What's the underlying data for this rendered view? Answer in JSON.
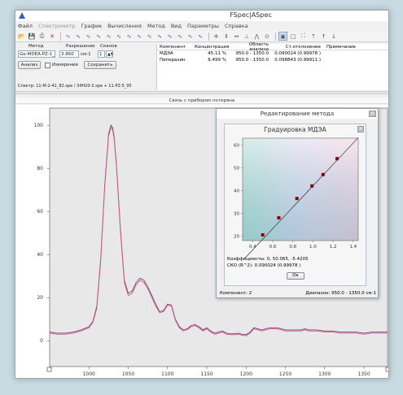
{
  "app": {
    "title": "FSpec|ASpec",
    "menu": [
      {
        "label": "Файл",
        "disabled": false
      },
      {
        "label": "Спектрометр",
        "disabled": true
      },
      {
        "label": "График",
        "disabled": false
      },
      {
        "label": "Вычисления",
        "disabled": false
      },
      {
        "label": "Метод",
        "disabled": false
      },
      {
        "label": "Вид",
        "disabled": false
      },
      {
        "label": "Параметры",
        "disabled": false
      },
      {
        "label": "Справка",
        "disabled": false
      }
    ],
    "toolbar_icons": [
      "open-icon",
      "save-icon",
      "print-icon",
      "delete-icon",
      "spectrum-tool-1-icon",
      "spectrum-tool-2-icon",
      "spectrum-tool-3-icon",
      "spectrum-tool-4-icon",
      "spectrum-tool-5-icon",
      "spectrum-tool-6-icon",
      "spectrum-tool-7-icon",
      "spectrum-tool-8-icon",
      "spectrum-tool-9-icon",
      "spectrum-tool-10-icon",
      "spectrum-tool-11-icon",
      "spectrum-tool-12-icon",
      "spectrum-tool-13-icon",
      "spectrum-tool-14-icon",
      "cursor-cross-icon",
      "vertical-line-icon",
      "horizontal-arrows-icon",
      "baseline-icon",
      "peak-icon",
      "zoom-reset-icon",
      "monitor-icon",
      "square-icon",
      "fit-icon",
      "up-arrow-1-icon",
      "up-arrow-2-icon",
      "down-arrow-icon"
    ]
  },
  "controls": {
    "method_label": "Метод",
    "method_value": "Ge-MDEA-PZ-1_0",
    "resolution_label": "Разрешение",
    "resolution_value": "3.860",
    "resolution_unit": "см-1",
    "scans_label": "Сканов",
    "scans_value": "1",
    "analyze_button": "Анализ",
    "measurement_label": "Измерение",
    "save_button": "Сохранить",
    "spectrum_line": "Спектр: 11-M-2-41_82.spe / 34H20-3.spe + 11-PZ-5_95"
  },
  "results": {
    "headers": [
      "Компонент",
      "Концентрация",
      "Область анализа",
      "Ст.отклонение",
      "Примечание"
    ],
    "rows": [
      [
        "МДЭА",
        "45.11 %",
        "950.0 - 1350.0",
        "0.090024 (0.99978 )",
        ""
      ],
      [
        "Пиперазин",
        "6.499 %",
        "950.0 - 1350.0",
        "0.098843 (0.99911 )",
        ""
      ]
    ]
  },
  "status": "Связь с прибором потеряна",
  "dialog": {
    "title": "Редактирование метода",
    "inner_title": "Градуировка МДЭА",
    "coefficients": "Коэффициенты: 0, 50.065, -5.4205",
    "sko": "СКО (R^2): 0.090024 (0.99978 )",
    "ok_button": "Ок",
    "component_label": "Компонент: 2",
    "range_label": "Диапазон: 950.0 - 1350.0 см-1"
  },
  "chart_data": [
    {
      "type": "line",
      "title": "",
      "xlabel": "",
      "ylabel": "",
      "xlim": [
        950,
        1380
      ],
      "ylim": [
        -12,
        108
      ],
      "xticks": [
        1000,
        1050,
        1100,
        1150,
        1200,
        1250,
        1300,
        1350
      ],
      "yticks": [
        0,
        20,
        40,
        60,
        80,
        100
      ],
      "series": [
        {
          "color": "#7a3a7a",
          "x": [
            950,
            960,
            970,
            980,
            990,
            1000,
            1005,
            1010,
            1015,
            1020,
            1025,
            1028,
            1030,
            1032,
            1035,
            1040,
            1045,
            1050,
            1055,
            1060,
            1065,
            1070,
            1075,
            1080,
            1085,
            1090,
            1095,
            1100,
            1105,
            1110,
            1115,
            1120,
            1125,
            1130,
            1135,
            1140,
            1145,
            1150,
            1155,
            1160,
            1165,
            1170,
            1175,
            1180,
            1185,
            1190,
            1195,
            1200,
            1205,
            1210,
            1220,
            1230,
            1240,
            1250,
            1260,
            1270,
            1275,
            1280,
            1290,
            1300,
            1310,
            1320,
            1330,
            1340,
            1350,
            1360,
            1370,
            1380
          ],
          "y": [
            4,
            3.5,
            3.5,
            4,
            5,
            6.5,
            9,
            16,
            38,
            72,
            96,
            100,
            99,
            95,
            82,
            52,
            28,
            22,
            23,
            27,
            29,
            28,
            25,
            21,
            17,
            13.5,
            14,
            17,
            16.5,
            10,
            6.5,
            5,
            5.5,
            7,
            7.5,
            6.5,
            5,
            6,
            4.5,
            3.5,
            4,
            4.5,
            3.5,
            3.2,
            3.2,
            3.5,
            3,
            2.8,
            4,
            6,
            5,
            6,
            6,
            5,
            5,
            5,
            5.5,
            5,
            5,
            4.5,
            4.5,
            4,
            4,
            4,
            3.5,
            4,
            4,
            4
          ]
        },
        {
          "color": "#d06080",
          "x": [
            950,
            960,
            970,
            980,
            990,
            1000,
            1005,
            1010,
            1015,
            1020,
            1025,
            1028,
            1030,
            1032,
            1035,
            1040,
            1045,
            1050,
            1055,
            1060,
            1065,
            1070,
            1075,
            1080,
            1085,
            1090,
            1095,
            1100,
            1105,
            1110,
            1115,
            1120,
            1125,
            1130,
            1135,
            1140,
            1145,
            1150,
            1155,
            1160,
            1165,
            1170,
            1175,
            1180,
            1185,
            1190,
            1195,
            1200,
            1205,
            1210,
            1220,
            1230,
            1240,
            1250,
            1260,
            1270,
            1275,
            1280,
            1290,
            1300,
            1310,
            1320,
            1330,
            1340,
            1350,
            1360,
            1370,
            1380
          ],
          "y": [
            3.5,
            3,
            3,
            3.5,
            4.5,
            6,
            8.5,
            15,
            37,
            71,
            95,
            99,
            98,
            94,
            81,
            51,
            27,
            21,
            22,
            26,
            28,
            27,
            24,
            20,
            16,
            13,
            13.5,
            16.5,
            16,
            9.5,
            6,
            4.5,
            5,
            6.5,
            7,
            6,
            4.5,
            5.5,
            4,
            3,
            3.5,
            4,
            3,
            2.8,
            2.8,
            3,
            2.5,
            2.3,
            3.5,
            5.5,
            4.5,
            5.5,
            5.5,
            4.5,
            4.5,
            4.5,
            5,
            4.5,
            4.5,
            4,
            4,
            3.5,
            3.5,
            3.5,
            3,
            3.5,
            3.5,
            3.5
          ]
        }
      ]
    },
    {
      "type": "scatter",
      "title": "Градуировка МДЭА",
      "xlabel": "",
      "ylabel": "",
      "xlim": [
        0.3,
        1.45
      ],
      "ylim": [
        18,
        63
      ],
      "xticks": [
        0.4,
        0.6,
        0.8,
        1.0,
        1.2,
        1.4
      ],
      "yticks": [
        20,
        30,
        40,
        50,
        60
      ],
      "series": [
        {
          "color": "#8b0000",
          "x": [
            0.5,
            0.66,
            0.84,
            0.99,
            1.1,
            1.24
          ],
          "y": [
            20.5,
            28,
            36.5,
            42,
            47,
            54
          ]
        }
      ],
      "fit_line": {
        "x": [
          0.3,
          1.45
        ],
        "y": [
          9.2,
          63.2
        ]
      }
    }
  ]
}
